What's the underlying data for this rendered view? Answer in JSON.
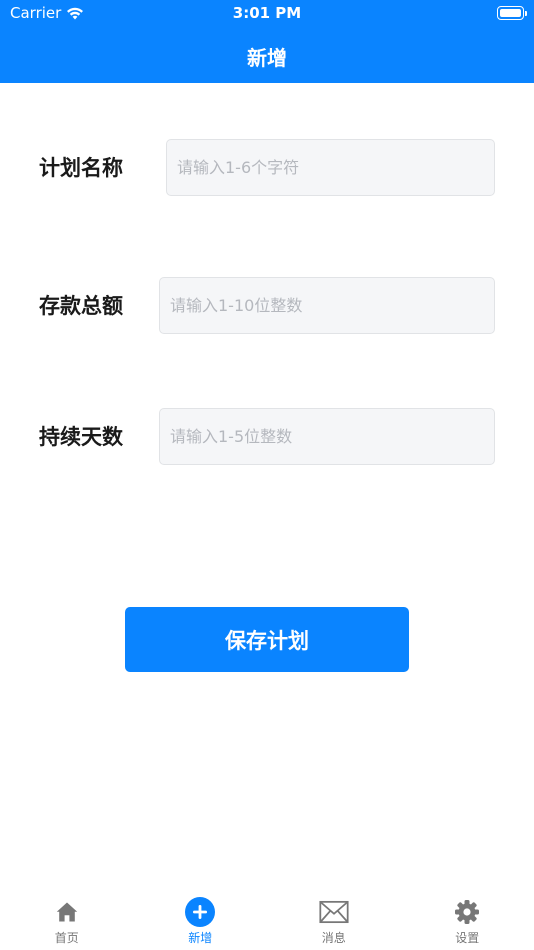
{
  "status_bar": {
    "carrier": "Carrier",
    "time": "3:01 PM"
  },
  "nav": {
    "title": "新增"
  },
  "form": {
    "fields": [
      {
        "label": "计划名称",
        "placeholder": "请输入1-6个字符",
        "value": ""
      },
      {
        "label": "存款总额",
        "placeholder": "请输入1-10位整数",
        "value": ""
      },
      {
        "label": "持续天数",
        "placeholder": "请输入1-5位整数",
        "value": ""
      }
    ],
    "save_label": "保存计划"
  },
  "tabs": [
    {
      "label": "首页",
      "icon": "home-icon",
      "active": false
    },
    {
      "label": "新增",
      "icon": "plus-circle-icon",
      "active": true
    },
    {
      "label": "消息",
      "icon": "envelope-icon",
      "active": false
    },
    {
      "label": "设置",
      "icon": "gear-icon",
      "active": false
    }
  ],
  "colors": {
    "accent": "#0a84ff",
    "inactive": "#777777",
    "input_bg": "#f5f6f8"
  }
}
